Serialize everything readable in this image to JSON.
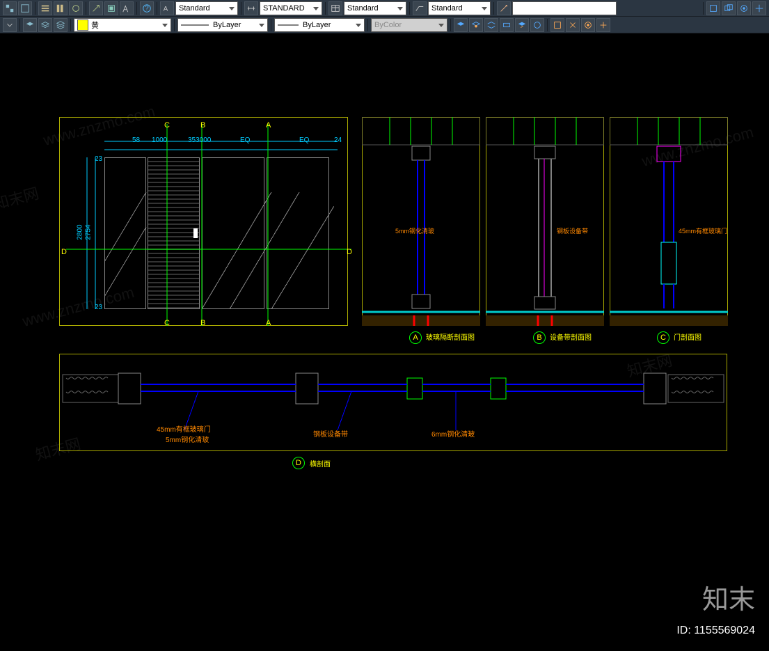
{
  "toolbar1": {
    "select_textstyle": "Standard",
    "select_dimstyle": "STANDARD",
    "select_tablestyle": "Standard",
    "select_mleader": "Standard",
    "search_placeholder": ""
  },
  "toolbar2": {
    "color_swatch": "#ffff00",
    "color_label": "黄",
    "linetype": "ByLayer",
    "lineweight": "ByLayer",
    "plotstyle": "ByColor"
  },
  "drawing": {
    "elevation": {
      "dims": {
        "h1": "58",
        "h2": "1000",
        "h3": "353000",
        "h4": "EQ",
        "h5": "EQ",
        "h6": "24",
        "v1": "23",
        "v2": "2754",
        "v3": "2800",
        "v4": "23"
      },
      "section_marks": [
        "C",
        "B",
        "A",
        "D",
        "C",
        "B",
        "A",
        "D"
      ]
    },
    "sections": {
      "a_label": "玻璃隔断剖面图",
      "b_label": "设备带剖面图",
      "c_label": "门剖面图",
      "d_label": "横剖面",
      "a_tag": "A",
      "b_tag": "B",
      "c_tag": "C",
      "d_tag": "D",
      "note_a": "5mm钢化清玻",
      "note_b": "钢板设备带",
      "note_c": "45mm有框玻璃门"
    },
    "plan_section": {
      "note1": "45mm有框玻璃门",
      "note2": "5mm钢化清玻",
      "note3": "钢板设备带",
      "note4": "6mm钢化清玻"
    }
  },
  "watermark_text": "www.znzmo.com",
  "watermark_cn": "知末网",
  "brand_text": "知末",
  "id_label": "ID: 1155569024"
}
